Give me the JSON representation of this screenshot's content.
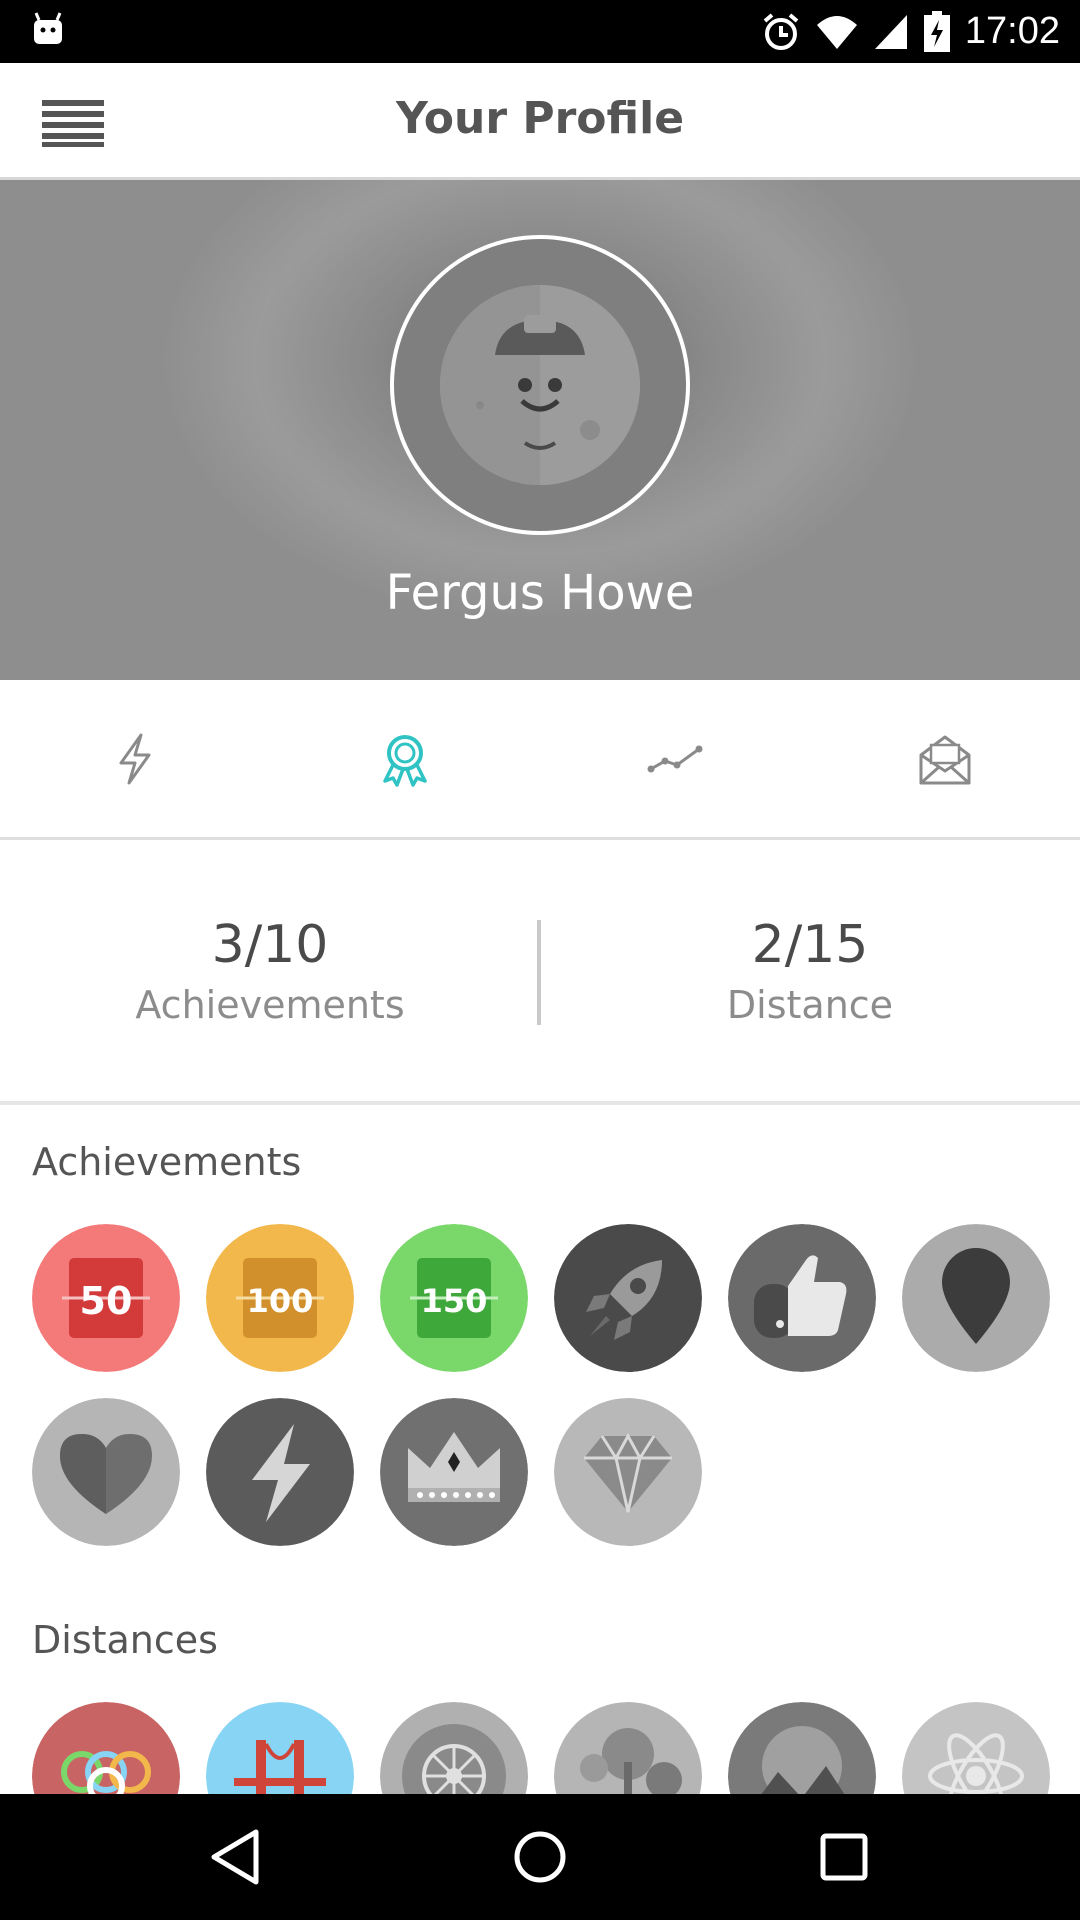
{
  "status_bar": {
    "time": "17:02"
  },
  "toolbar": {
    "title": "Your Profile"
  },
  "profile": {
    "name": "Fergus Howe"
  },
  "tabs": [
    "activity",
    "achievements",
    "stats",
    "messages"
  ],
  "stats": {
    "achievements": {
      "value": "3/10",
      "label": "Achievements"
    },
    "distance": {
      "value": "2/15",
      "label": "Distance"
    }
  },
  "sections": {
    "achievements_title": "Achievements",
    "distances_title": "Distances"
  },
  "achievement_badges": [
    {
      "icon": "steps-50-icon",
      "text": "50",
      "color": "#f47a7a",
      "earned": true
    },
    {
      "icon": "steps-100-icon",
      "text": "100",
      "color": "#f2b84b",
      "earned": true
    },
    {
      "icon": "steps-150-icon",
      "text": "150",
      "color": "#7ad86a",
      "earned": true
    },
    {
      "icon": "rocket-icon",
      "color": "#4a4a4a",
      "earned": false
    },
    {
      "icon": "thumbs-up-icon",
      "color": "#6a6a6a",
      "earned": false
    },
    {
      "icon": "location-pin-icon",
      "color": "#ababab",
      "earned": false
    },
    {
      "icon": "heart-icon",
      "color": "#b5b5b5",
      "earned": false
    },
    {
      "icon": "lightning-icon",
      "color": "#5b5b5b",
      "earned": false
    },
    {
      "icon": "crown-icon",
      "color": "#707070",
      "earned": false
    },
    {
      "icon": "diamond-icon",
      "color": "#b8b8b8",
      "earned": false
    }
  ],
  "distance_badges": [
    {
      "icon": "rings-icon",
      "color": "#c96464"
    },
    {
      "icon": "bridge-icon",
      "color": "#87d4f5"
    },
    {
      "icon": "world-walking-icon",
      "color": "#b0b0b0"
    },
    {
      "icon": "trees-icon",
      "color": "#b5b5b5"
    },
    {
      "icon": "mountains-icon",
      "color": "#7a7a7a"
    },
    {
      "icon": "atom-icon",
      "color": "#c4c4c4"
    }
  ],
  "colors": {
    "accent": "#2fc3c3",
    "text_dark": "#4a4a4a",
    "text_muted": "#8c8c8c"
  }
}
